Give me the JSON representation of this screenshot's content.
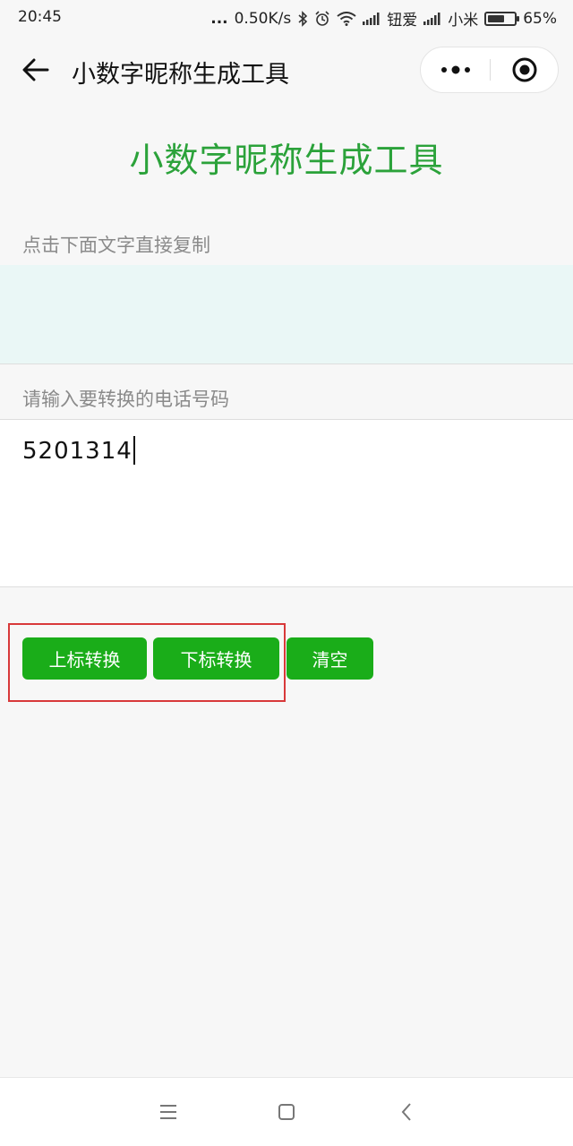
{
  "status_bar": {
    "time": "20:45",
    "dots": "...",
    "speed": "0.50K/s",
    "carrier1": "钮爱",
    "carrier2": "小米",
    "battery_percent_text": "65%",
    "battery_level": 0.65
  },
  "nav": {
    "title": "小数字昵称生成工具"
  },
  "main": {
    "heading": "小数字昵称生成工具",
    "copy_label": "点击下面文字直接复制",
    "result_text": "",
    "input_label": "请输入要转换的电话号码",
    "input_value": "5201314"
  },
  "buttons": {
    "superscript": "上标转换",
    "subscript": "下标转换",
    "clear": "清空"
  },
  "colors": {
    "accent_green": "#1aad19",
    "heading_green": "#2ba23a",
    "highlight_red": "#d8393a",
    "result_bg": "#eaf7f6"
  }
}
